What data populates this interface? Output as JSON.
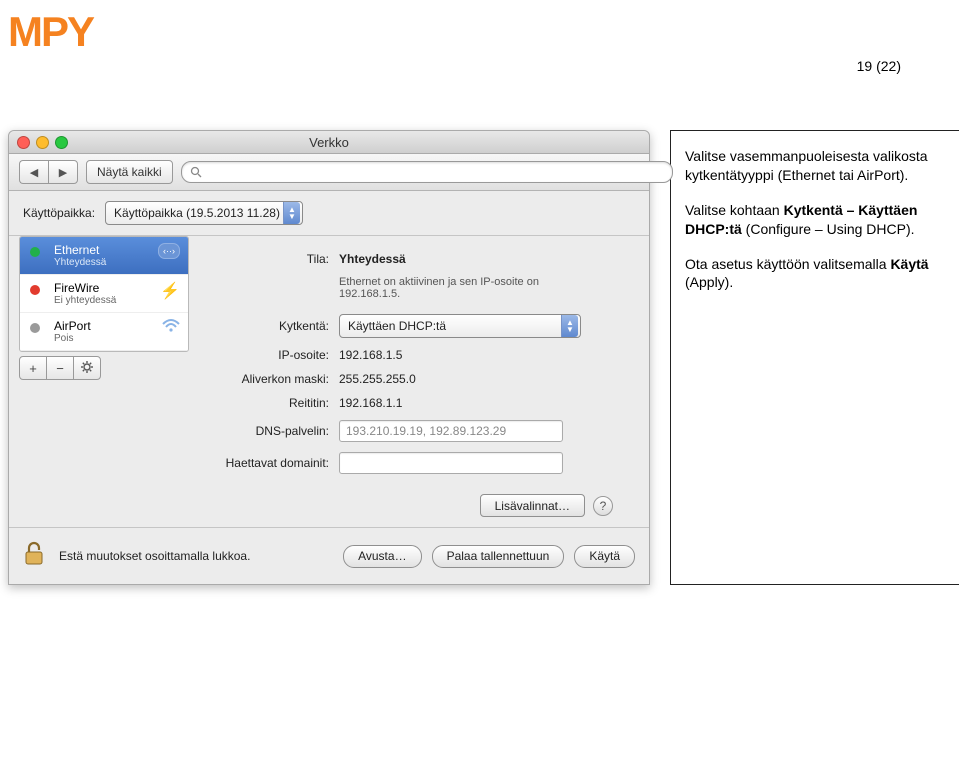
{
  "logo": "MPY",
  "page_number": "19 (22)",
  "window": {
    "title": "Verkko",
    "toolbar": {
      "show_all": "Näytä kaikki",
      "search_placeholder": ""
    },
    "location": {
      "label": "Käyttöpaikka:",
      "value": "Käyttöpaikka (19.5.2013 11.28)"
    },
    "sidebar": {
      "items": [
        {
          "name": "Ethernet",
          "sub": "Yhteydessä",
          "badge": "‹··›"
        },
        {
          "name": "FireWire",
          "sub": "Ei yhteydessä"
        },
        {
          "name": "AirPort",
          "sub": "Pois"
        }
      ]
    },
    "fields": {
      "status_label": "Tila:",
      "status_value": "Yhteydessä",
      "status_sub": "Ethernet on aktiivinen ja sen IP-osoite on 192.168.1.5.",
      "configure_label": "Kytkentä:",
      "configure_value": "Käyttäen DHCP:tä",
      "ip_label": "IP-osoite:",
      "ip_value": "192.168.1.5",
      "mask_label": "Aliverkon maski:",
      "mask_value": "255.255.255.0",
      "router_label": "Reititin:",
      "router_value": "192.168.1.1",
      "dns_label": "DNS-palvelin:",
      "dns_value": "193.210.19.19, 192.89.123.29",
      "domains_label": "Haettavat domainit:",
      "domains_value": ""
    },
    "advanced": "Lisävalinnat…",
    "footer": {
      "lock_text": "Estä muutokset osoittamalla lukkoa.",
      "help": "Avusta…",
      "revert": "Palaa tallennettuun",
      "apply": "Käytä"
    }
  },
  "instructions": {
    "p1a": "Valitse vasemmanpuoleisesta valikosta kytkentätyyppi ",
    "p1b": "(Ethernet tai AirPort).",
    "p2a": "Valitse kohtaan ",
    "p2b": "Kytkentä – Käyttäen DHCP:tä",
    "p2c": " (Configure – Using DHCP).",
    "p3a": "Ota asetus käyttöön valitsemalla ",
    "p3b": "Käytä",
    "p3c": " (Apply)."
  }
}
